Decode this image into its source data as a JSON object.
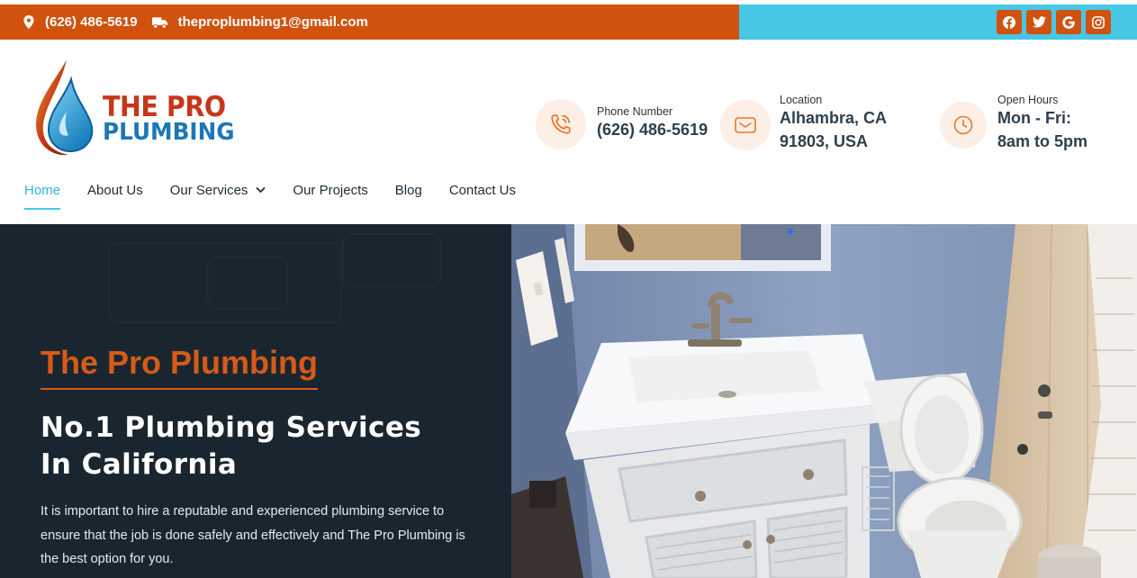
{
  "topbar": {
    "phone": "(626) 486-5619",
    "email": "theproplumbing1@gmail.com",
    "socials": [
      "facebook-icon",
      "twitter-icon",
      "google-icon",
      "instagram-icon"
    ],
    "colors": {
      "left": "#d0520e",
      "right": "#48c6e6"
    }
  },
  "logo": {
    "line1": "THE PRO",
    "line2": "PLUMBING"
  },
  "header_info": [
    {
      "icon": "phone-icon",
      "label": "Phone Number",
      "value": "(626) 486-5619"
    },
    {
      "icon": "mail-icon",
      "label": "Location",
      "value_line1": "Alhambra, CA",
      "value_line2": "91803, USA"
    },
    {
      "icon": "clock-icon",
      "label": "Open Hours",
      "value_line1": "Mon - Fri:",
      "value_line2": "8am to 5pm"
    }
  ],
  "nav": {
    "items": [
      {
        "label": "Home",
        "active": true
      },
      {
        "label": "About Us"
      },
      {
        "label": "Our Services",
        "dropdown": true
      },
      {
        "label": "Our Projects"
      },
      {
        "label": "Blog"
      },
      {
        "label": "Contact Us"
      }
    ]
  },
  "hero": {
    "kicker": "The Pro Plumbing",
    "title": "No.1 Plumbing Services\nIn California",
    "description": "It is important to hire a reputable and experienced plumbing service to ensure that the job is done safely and effectively and The Pro Plumbing is the best option for you."
  }
}
